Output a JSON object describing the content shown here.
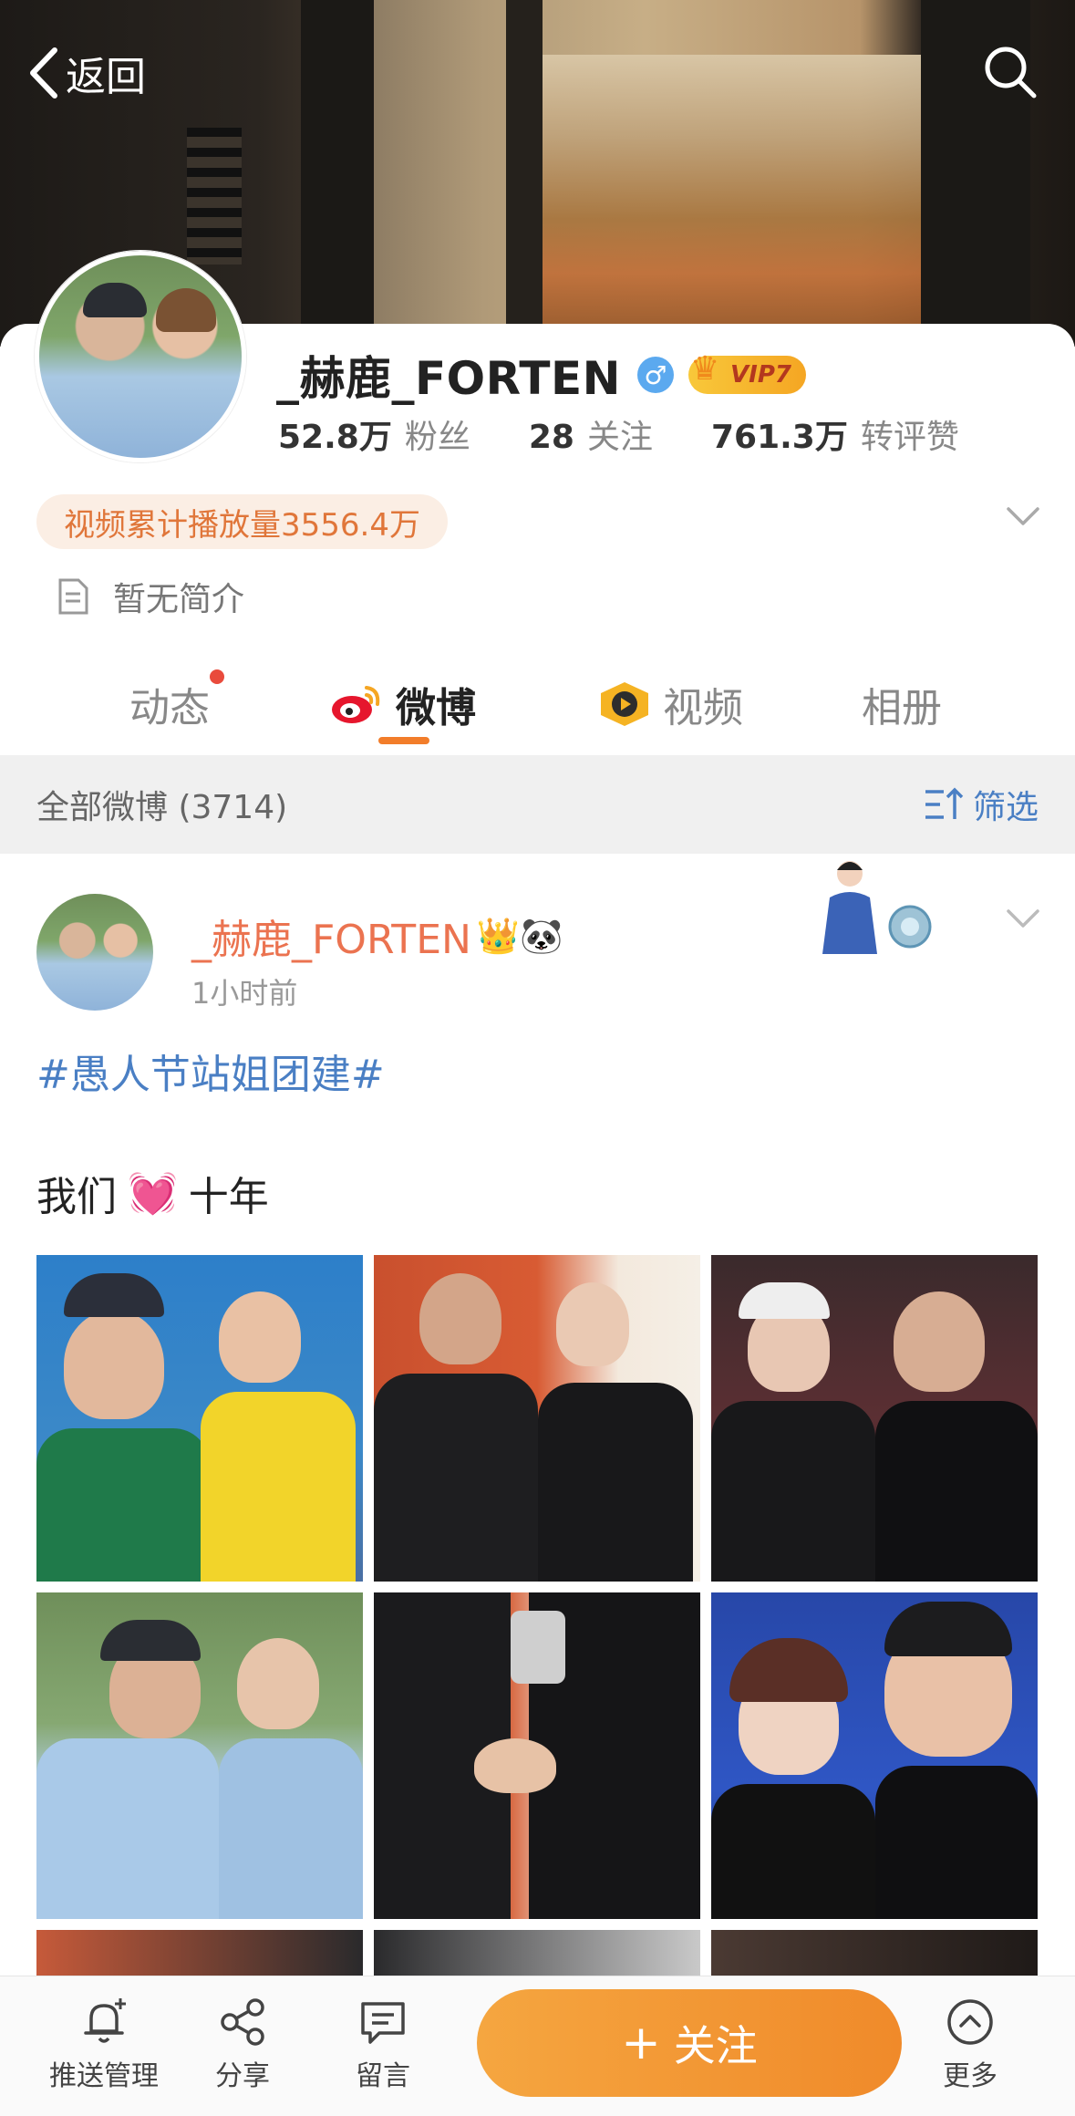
{
  "nav": {
    "back_label": "返回"
  },
  "profile": {
    "username": "_赫鹿_FORTEN",
    "gender_symbol": "♂",
    "vip_label": "VIP7",
    "stats": [
      {
        "value": "52.8万",
        "label": "粉丝"
      },
      {
        "value": "28",
        "label": "关注"
      },
      {
        "value": "761.3万",
        "label": "转评赞"
      }
    ],
    "video_plays": "视频累计播放量3556.4万",
    "bio": "暂无简介"
  },
  "tabs": [
    {
      "label": "动态",
      "has_dot": true
    },
    {
      "label": "微博",
      "active": true
    },
    {
      "label": "视频"
    },
    {
      "label": "相册"
    }
  ],
  "feed": {
    "title": "全部微博 (3714)",
    "filter_label": "筛选"
  },
  "post": {
    "author": "_赫鹿_FORTEN",
    "author_emojis": "👑🐼",
    "time": "1小时前",
    "hashtag": "#愚人节站姐团建#",
    "text_before": "我们",
    "text_emoji": "💓",
    "text_after": "十年"
  },
  "bottom_bar": {
    "push_label": "推送管理",
    "share_label": "分享",
    "message_label": "留言",
    "follow_label": "关注",
    "more_label": "更多"
  },
  "colors": {
    "accent": "#f27d2a",
    "link": "#4a7fc4",
    "name": "#eb7350"
  }
}
